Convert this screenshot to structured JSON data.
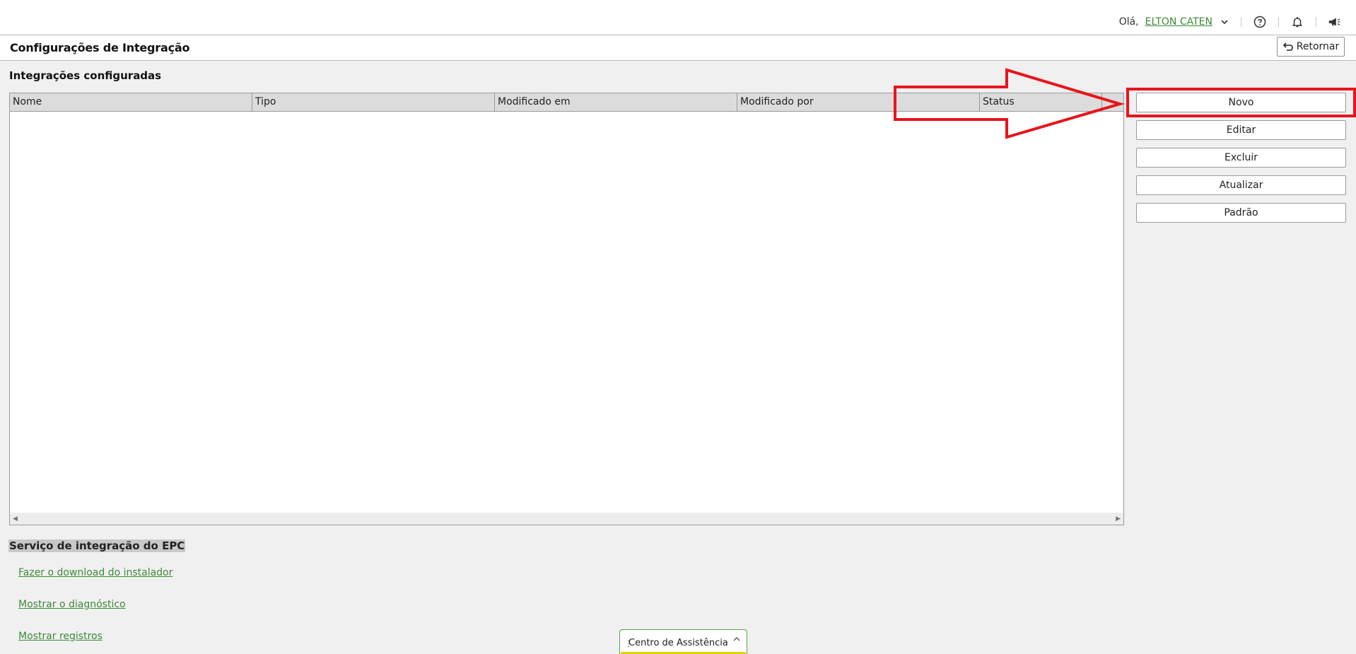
{
  "topbar": {
    "greeting": "Olá,",
    "user_name": "ELTON CATEN",
    "icons": [
      "chevron-down-icon",
      "help-icon",
      "bell-icon",
      "megaphone-icon"
    ]
  },
  "header": {
    "title": "Configurações de Integração",
    "return_label": "Retornar"
  },
  "integrations": {
    "section_title": "Integrações configuradas",
    "columns": [
      "Nome",
      "Tipo",
      "Modificado em",
      "Modificado por",
      "Status"
    ],
    "rows": []
  },
  "actions": {
    "new_label": "Novo",
    "edit_label": "Editar",
    "delete_label": "Excluir",
    "refresh_label": "Atualizar",
    "default_label": "Padrão"
  },
  "epc_service": {
    "title": "Serviço de integração do EPC",
    "links": [
      "Fazer o download do instalador",
      "Mostrar o diagnóstico",
      "Mostrar registros"
    ]
  },
  "assistance": {
    "label": "Centro de Assistência"
  },
  "colors": {
    "link_green": "#3d8a37",
    "annotation_red": "#e8141c",
    "assist_accent": "#e3d400"
  }
}
